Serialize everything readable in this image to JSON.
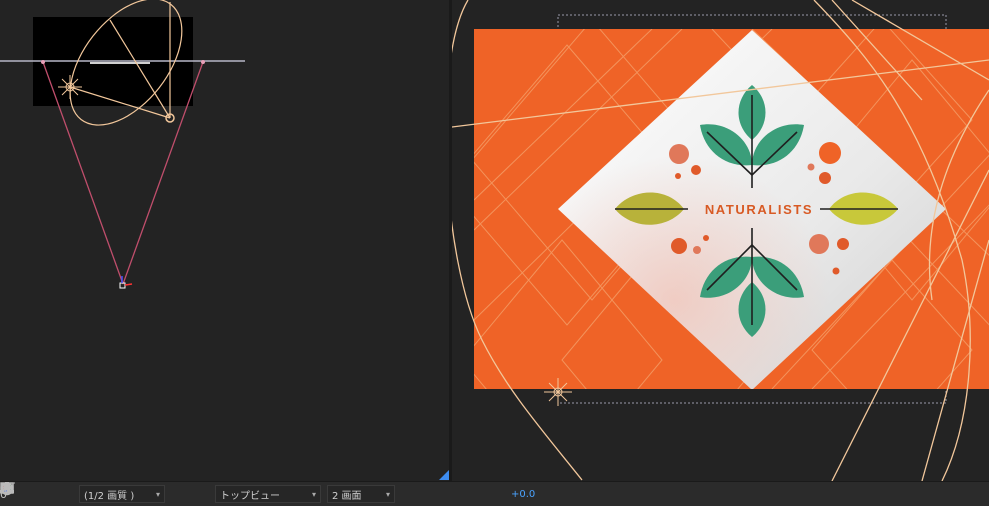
{
  "toolbar": {
    "magnification_fragment": "0",
    "resolution": "(1/2 画質 )",
    "view_mode": "トップビュー",
    "layout": "2 画面",
    "exposure": "+0.0",
    "icons": [
      "camera-icon",
      "show-snapshot-icon",
      "color-channels-icon",
      "resolution-dropdown",
      "region-of-interest-icon",
      "transparency-grid-icon",
      "3d-view-dropdown",
      "view-layout-dropdown",
      "toggle-pixel-aspect-icon",
      "fast-preview-icon",
      "timeline-icon",
      "flowchart-icon",
      "exposure-reset-icon"
    ]
  },
  "card": {
    "title": "NATURALISTS"
  },
  "colors": {
    "background": "#232323",
    "orange": "#ef6327",
    "leaf_green": "#3b9e7a",
    "leaf_yellow": "#c8c83a",
    "accent_blue": "#3d8cf0",
    "camera_wire": "#f2c79b"
  }
}
